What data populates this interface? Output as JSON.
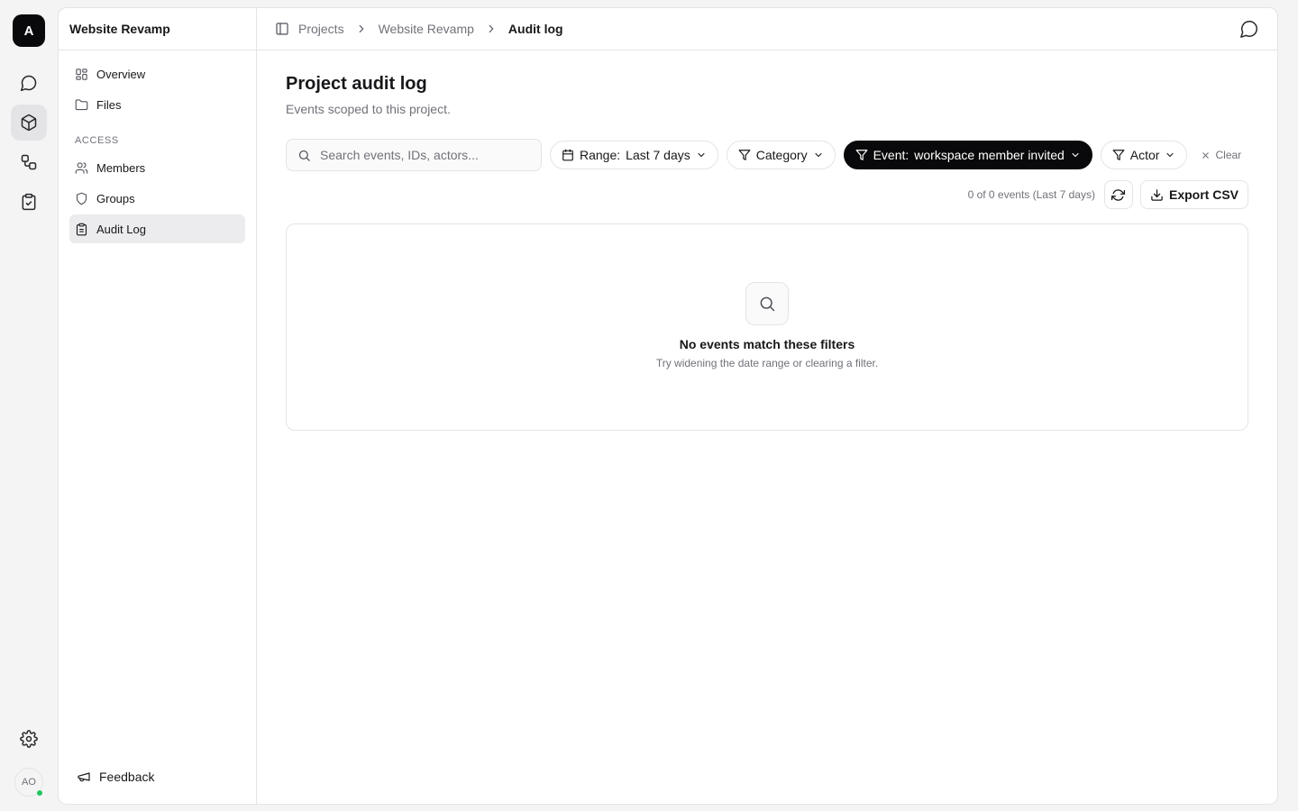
{
  "rail": {
    "logo": "A",
    "items": [
      {
        "name": "chat-icon"
      },
      {
        "name": "cube-icon"
      },
      {
        "name": "workflow-icon"
      },
      {
        "name": "clipboard-check-icon"
      }
    ],
    "avatar": "AO"
  },
  "sidebar": {
    "project": "Website Revamp",
    "items": [
      {
        "label": "Overview",
        "icon": "grid-icon"
      },
      {
        "label": "Files",
        "icon": "folder-icon"
      }
    ],
    "section": "ACCESS",
    "access_items": [
      {
        "label": "Members",
        "icon": "users-icon"
      },
      {
        "label": "Groups",
        "icon": "shield-icon"
      },
      {
        "label": "Audit Log",
        "icon": "clipboard-icon",
        "active": true
      }
    ],
    "feedback": "Feedback"
  },
  "topbar": {
    "crumbs": [
      "Projects",
      "Website Revamp",
      "Audit log"
    ]
  },
  "main": {
    "title": "Project audit log",
    "subtitle": "Events scoped to this project.",
    "search_placeholder": "Search events, IDs, actors...",
    "filters": {
      "range_label": "Range:",
      "range_value": "Last 7 days",
      "category": "Category",
      "event_label": "Event:",
      "event_value": "workspace member invited",
      "actor": "Actor",
      "clear": "Clear"
    },
    "count_text": "0 of 0 events (Last 7 days)",
    "export_label": "Export CSV",
    "empty_title": "No events match these filters",
    "empty_subtitle": "Try widening the date range or clearing a filter."
  }
}
